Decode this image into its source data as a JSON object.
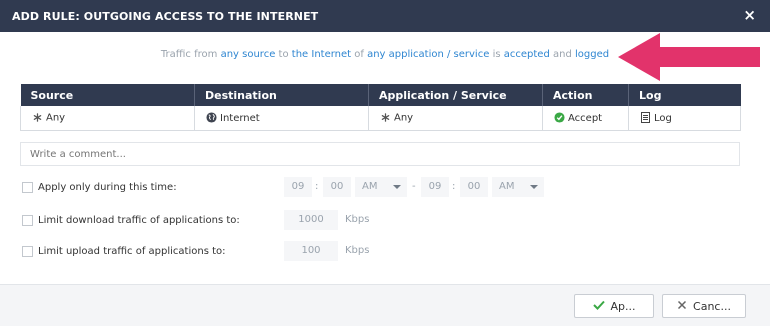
{
  "dialog": {
    "title": "ADD RULE: OUTGOING ACCESS TO THE INTERNET",
    "close_glyph": "×"
  },
  "summary": {
    "prefix": "Traffic from",
    "source_link": "any source",
    "to": "to",
    "destination_link": "the Internet",
    "of": "of",
    "application_link": "any application / service",
    "is": "is",
    "action_link": "accepted",
    "and": "and",
    "log_link": "logged"
  },
  "table": {
    "headers": [
      "Source",
      "Destination",
      "Application / Service",
      "Action",
      "Log"
    ],
    "row": {
      "source": "Any",
      "destination": "Internet",
      "application": "Any",
      "action": "Accept",
      "log": "Log"
    },
    "icons": {
      "source": "asterisk-icon",
      "destination": "globe-icon",
      "application": "asterisk-icon",
      "action": "accept-icon",
      "log": "document-icon"
    }
  },
  "comment": {
    "placeholder": "Write a comment..."
  },
  "options": {
    "time": {
      "label": "Apply only during this time:",
      "start_hour": "09",
      "start_minute": "00",
      "start_ampm": "AM",
      "dash": "-",
      "end_hour": "09",
      "end_minute": "00",
      "end_ampm": "AM",
      "colon": ":"
    },
    "download": {
      "label": "Limit download traffic of applications to:",
      "value": "1000",
      "unit": "Kbps"
    },
    "upload": {
      "label": "Limit upload traffic of applications to:",
      "value": "100",
      "unit": "Kbps"
    }
  },
  "footer": {
    "apply_label": "Ap...",
    "cancel_label": "Canc..."
  },
  "colors": {
    "header_bg": "#303a50",
    "link": "#2f86d1",
    "arrow": "#e2336b",
    "accept_green": "#3aa845"
  }
}
